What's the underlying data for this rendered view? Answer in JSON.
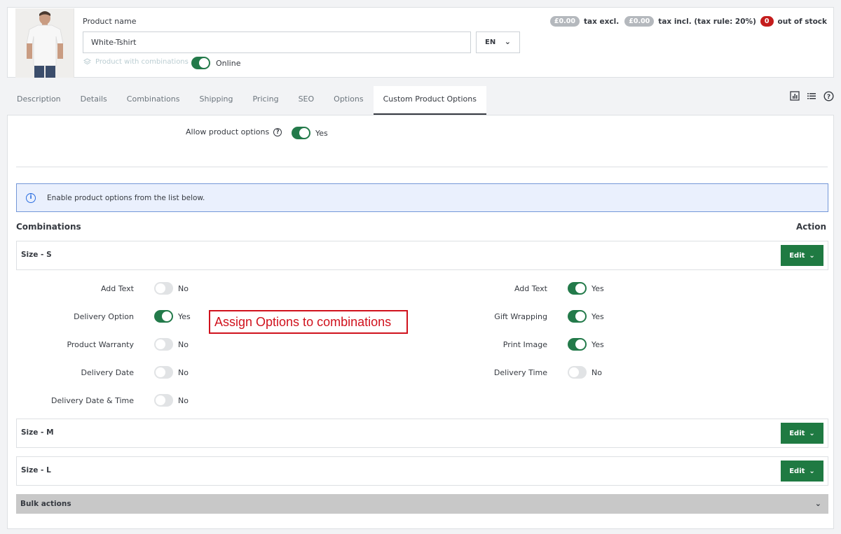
{
  "header": {
    "product_name_label": "Product name",
    "product_name_value": "White-Tshirt",
    "language": "EN",
    "combinations_label": "Product with combinations",
    "online_label": "Online",
    "online_enabled": true,
    "price_excl": "£0.00",
    "tax_excl_label": "tax excl.",
    "price_incl": "£0.00",
    "tax_incl_label": "tax incl. (tax rule: 20%)",
    "stock_count": "0",
    "stock_label": "out of stock"
  },
  "tabs": [
    {
      "label": "Description"
    },
    {
      "label": "Details"
    },
    {
      "label": "Combinations"
    },
    {
      "label": "Shipping"
    },
    {
      "label": "Pricing"
    },
    {
      "label": "SEO"
    },
    {
      "label": "Options"
    },
    {
      "label": "Custom Product Options",
      "active": true
    }
  ],
  "toolbar_icons": [
    "stats-icon",
    "list-icon",
    "help-icon"
  ],
  "allow": {
    "label": "Allow product options",
    "value": "Yes",
    "enabled": true
  },
  "info": {
    "text": "Enable product options from the list below."
  },
  "table": {
    "combinations_header": "Combinations",
    "action_header": "Action"
  },
  "combinations": [
    {
      "label": "Size - S",
      "edit": "Edit"
    },
    {
      "label": "Size - M",
      "edit": "Edit"
    },
    {
      "label": "Size - L",
      "edit": "Edit"
    }
  ],
  "options_left": [
    {
      "name": "Add Text",
      "value": "No",
      "enabled": false
    },
    {
      "name": "Delivery Option",
      "value": "Yes",
      "enabled": true
    },
    {
      "name": "Product Warranty",
      "value": "No",
      "enabled": false
    },
    {
      "name": "Delivery Date",
      "value": "No",
      "enabled": false
    },
    {
      "name": "Delivery Date & Time",
      "value": "No",
      "enabled": false
    }
  ],
  "options_right": [
    {
      "name": "Add Text",
      "value": "Yes",
      "enabled": true
    },
    {
      "name": "Gift Wrapping",
      "value": "Yes",
      "enabled": true
    },
    {
      "name": "Print Image",
      "value": "Yes",
      "enabled": true
    },
    {
      "name": "Delivery Time",
      "value": "No",
      "enabled": false
    }
  ],
  "annotation": "Assign Options to combinations",
  "bulk": {
    "label": "Bulk actions"
  },
  "colors": {
    "accent": "#237a4a",
    "button": "#1f7a42",
    "danger": "#c41c1c",
    "info_border": "#7497d8"
  }
}
